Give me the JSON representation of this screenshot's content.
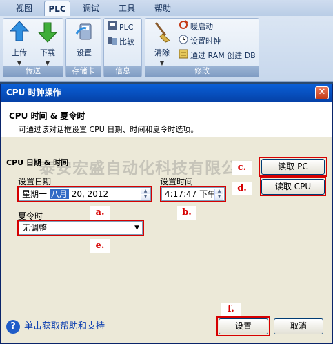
{
  "ribbon": {
    "tabs": [
      "视图",
      "PLC",
      "调试",
      "工具",
      "帮助"
    ],
    "active_tab": "PLC",
    "groups": {
      "transfer": {
        "label": "传送",
        "upload": "上传",
        "download": "下载"
      },
      "memory_card": {
        "label": "存储卡",
        "settings": "设置"
      },
      "info": {
        "label": "信息",
        "plc": "PLC",
        "compare": "比较"
      },
      "modify": {
        "label": "修改",
        "clear": "清除",
        "warm_start": "暖启动",
        "set_clock": "设置时钟",
        "create_db": "通过 RAM 创建 DB"
      }
    }
  },
  "dialog": {
    "title": "CPU 时钟操作",
    "close_glyph": "✕",
    "header_title": "CPU 时间 & 夏令时",
    "header_desc": "可通过该对话框设置 CPU 日期、时间和夏令时选项。",
    "section_title": "CPU 日期 & 时间",
    "watermark": "泰安宏盛自动化科技有限公司",
    "date_label": "设置日期",
    "date_weekday": "星期一",
    "date_month": "八月",
    "date_rest": "20, 2012",
    "time_label": "设置时间",
    "time_value": "4:17:47 下午",
    "dst_label": "夏令时",
    "dst_value": "无调整",
    "read_pc": "读取 PC",
    "read_cpu": "读取 CPU",
    "settings_btn": "设置",
    "cancel_btn": "取消",
    "help_text": "单击获取帮助和支持",
    "help_icon": "?"
  },
  "annotations": {
    "a": "a.",
    "b": "b.",
    "c": "c.",
    "d": "d.",
    "e": "e.",
    "f": "f."
  },
  "colors": {
    "highlight_red": "#d60000",
    "titlebar_blue": "#0542a8"
  }
}
